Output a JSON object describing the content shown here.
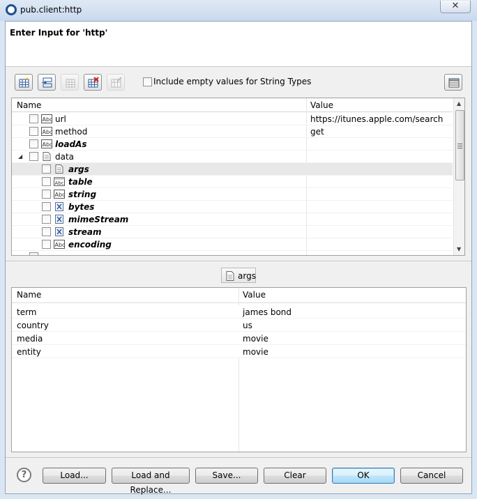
{
  "window": {
    "title": "pub.client:http",
    "close_glyph": "✕",
    "accent": "#1d4f8c"
  },
  "header": {
    "title": "Enter Input for 'http'"
  },
  "toolbar": {
    "buttons": [
      {
        "icon": "add-row-icon",
        "enabled": true
      },
      {
        "icon": "insert-row-icon",
        "enabled": true
      },
      {
        "icon": "table-icon",
        "enabled": false
      },
      {
        "icon": "delete-row-icon",
        "enabled": true
      },
      {
        "icon": "edit-table-icon",
        "enabled": false
      }
    ],
    "include_empty_label": "Include empty values for String Types",
    "include_empty_checked": false,
    "view_toggle_icon": "grid-view-icon"
  },
  "input_tree": {
    "columns": {
      "name": "Name",
      "value": "Value"
    },
    "rows": [
      {
        "name": "url",
        "value": "https://itunes.apple.com/search",
        "icon": "string-icon",
        "level": 0,
        "style": "normal"
      },
      {
        "name": "method",
        "value": "get",
        "icon": "string-icon",
        "level": 0,
        "style": "normal"
      },
      {
        "name": "loadAs",
        "value": "",
        "icon": "string-icon",
        "level": 0,
        "style": "bold-italic"
      },
      {
        "name": "data",
        "value": "",
        "icon": "document-icon",
        "level": 0,
        "style": "normal",
        "expanded": true
      },
      {
        "name": "args",
        "value": "",
        "icon": "document-icon",
        "level": 1,
        "style": "bold-italic",
        "selected": true
      },
      {
        "name": "table",
        "value": "",
        "icon": "string-table-icon",
        "level": 1,
        "style": "bold-italic"
      },
      {
        "name": "string",
        "value": "",
        "icon": "string-icon",
        "level": 1,
        "style": "bold-italic"
      },
      {
        "name": "bytes",
        "value": "",
        "icon": "object-icon",
        "level": 1,
        "style": "bold-italic"
      },
      {
        "name": "mimeStream",
        "value": "",
        "icon": "object-icon",
        "level": 1,
        "style": "bold-italic"
      },
      {
        "name": "stream",
        "value": "",
        "icon": "object-icon",
        "level": 1,
        "style": "bold-italic"
      },
      {
        "name": "encoding",
        "value": "",
        "icon": "string-icon",
        "level": 1,
        "style": "bold-italic"
      }
    ]
  },
  "args_panel": {
    "label": "args",
    "columns": {
      "name": "Name",
      "value": "Value"
    },
    "rows": [
      {
        "name": "term",
        "value": "james bond"
      },
      {
        "name": "country",
        "value": "us"
      },
      {
        "name": "media",
        "value": "movie"
      },
      {
        "name": "entity",
        "value": "movie"
      }
    ]
  },
  "footer": {
    "help_glyph": "?",
    "load": "Load...",
    "load_replace": "Load and Replace...",
    "save": "Save...",
    "clear": "Clear",
    "ok": "OK",
    "cancel": "Cancel"
  }
}
